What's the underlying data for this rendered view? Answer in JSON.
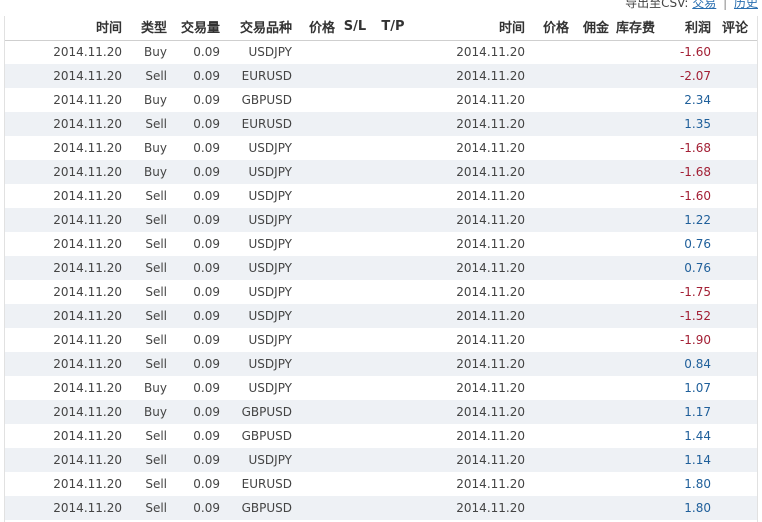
{
  "export": {
    "label": "导出至CSV:",
    "trades_link": "交易",
    "separator": "|",
    "history_link": "历史"
  },
  "columns": {
    "open_time": "时间",
    "type": "类型",
    "volume": "交易量",
    "symbol": "交易品种",
    "price": "价格",
    "sl": "S/L",
    "tp": "T/P",
    "close_time": "时间",
    "close_price": "价格",
    "commission": "佣金",
    "swap": "库存费",
    "profit": "利润",
    "comment": "评论"
  },
  "colors": {
    "negative": "#a32035",
    "positive": "#1f5f9a",
    "row_alt": "#eef1f5"
  },
  "rows": [
    {
      "open_time": "2014.11.20",
      "type": "Buy",
      "volume": "0.09",
      "symbol": "USDJPY",
      "close_time": "2014.11.20",
      "profit": "-1.60"
    },
    {
      "open_time": "2014.11.20",
      "type": "Sell",
      "volume": "0.09",
      "symbol": "EURUSD",
      "close_time": "2014.11.20",
      "profit": "-2.07"
    },
    {
      "open_time": "2014.11.20",
      "type": "Buy",
      "volume": "0.09",
      "symbol": "GBPUSD",
      "close_time": "2014.11.20",
      "profit": "2.34"
    },
    {
      "open_time": "2014.11.20",
      "type": "Sell",
      "volume": "0.09",
      "symbol": "EURUSD",
      "close_time": "2014.11.20",
      "profit": "1.35"
    },
    {
      "open_time": "2014.11.20",
      "type": "Buy",
      "volume": "0.09",
      "symbol": "USDJPY",
      "close_time": "2014.11.20",
      "profit": "-1.68"
    },
    {
      "open_time": "2014.11.20",
      "type": "Buy",
      "volume": "0.09",
      "symbol": "USDJPY",
      "close_time": "2014.11.20",
      "profit": "-1.68"
    },
    {
      "open_time": "2014.11.20",
      "type": "Sell",
      "volume": "0.09",
      "symbol": "USDJPY",
      "close_time": "2014.11.20",
      "profit": "-1.60"
    },
    {
      "open_time": "2014.11.20",
      "type": "Sell",
      "volume": "0.09",
      "symbol": "USDJPY",
      "close_time": "2014.11.20",
      "profit": "1.22"
    },
    {
      "open_time": "2014.11.20",
      "type": "Sell",
      "volume": "0.09",
      "symbol": "USDJPY",
      "close_time": "2014.11.20",
      "profit": "0.76"
    },
    {
      "open_time": "2014.11.20",
      "type": "Sell",
      "volume": "0.09",
      "symbol": "USDJPY",
      "close_time": "2014.11.20",
      "profit": "0.76"
    },
    {
      "open_time": "2014.11.20",
      "type": "Sell",
      "volume": "0.09",
      "symbol": "USDJPY",
      "close_time": "2014.11.20",
      "profit": "-1.75"
    },
    {
      "open_time": "2014.11.20",
      "type": "Sell",
      "volume": "0.09",
      "symbol": "USDJPY",
      "close_time": "2014.11.20",
      "profit": "-1.52"
    },
    {
      "open_time": "2014.11.20",
      "type": "Sell",
      "volume": "0.09",
      "symbol": "USDJPY",
      "close_time": "2014.11.20",
      "profit": "-1.90"
    },
    {
      "open_time": "2014.11.20",
      "type": "Sell",
      "volume": "0.09",
      "symbol": "USDJPY",
      "close_time": "2014.11.20",
      "profit": "0.84"
    },
    {
      "open_time": "2014.11.20",
      "type": "Buy",
      "volume": "0.09",
      "symbol": "USDJPY",
      "close_time": "2014.11.20",
      "profit": "1.07"
    },
    {
      "open_time": "2014.11.20",
      "type": "Buy",
      "volume": "0.09",
      "symbol": "GBPUSD",
      "close_time": "2014.11.20",
      "profit": "1.17"
    },
    {
      "open_time": "2014.11.20",
      "type": "Sell",
      "volume": "0.09",
      "symbol": "GBPUSD",
      "close_time": "2014.11.20",
      "profit": "1.44"
    },
    {
      "open_time": "2014.11.20",
      "type": "Sell",
      "volume": "0.09",
      "symbol": "USDJPY",
      "close_time": "2014.11.20",
      "profit": "1.14"
    },
    {
      "open_time": "2014.11.20",
      "type": "Sell",
      "volume": "0.09",
      "symbol": "EURUSD",
      "close_time": "2014.11.20",
      "profit": "1.80"
    },
    {
      "open_time": "2014.11.20",
      "type": "Sell",
      "volume": "0.09",
      "symbol": "GBPUSD",
      "close_time": "2014.11.20",
      "profit": "1.80"
    }
  ]
}
